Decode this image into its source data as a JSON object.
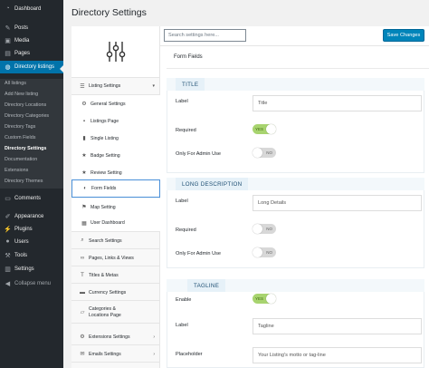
{
  "wp_menu": {
    "items": [
      {
        "label": "Dashboard",
        "icon": "dashboard-icon"
      },
      {
        "label": "Posts",
        "icon": "pin-icon"
      },
      {
        "label": "Media",
        "icon": "media-icon"
      },
      {
        "label": "Pages",
        "icon": "page-icon"
      },
      {
        "label": "Directory listings",
        "icon": "globe-icon"
      }
    ],
    "submenu": [
      "All listings",
      "Add New listing",
      "Directory Locations",
      "Directory Categories",
      "Directory Tags",
      "Custom Fields",
      "Directory Settings",
      "Documentation",
      "Extensions",
      "Directory Themes"
    ],
    "bottom_items": [
      {
        "label": "Comments",
        "icon": "comment-icon"
      },
      {
        "label": "Appearance",
        "icon": "brush-icon"
      },
      {
        "label": "Plugins",
        "icon": "plug-icon"
      },
      {
        "label": "Users",
        "icon": "user-icon"
      },
      {
        "label": "Tools",
        "icon": "wrench-icon"
      },
      {
        "label": "Settings",
        "icon": "settings-icon"
      },
      {
        "label": "Collapse menu",
        "icon": "collapse-icon"
      }
    ]
  },
  "page": {
    "title": "Directory Settings",
    "search_placeholder": "Search settings here...",
    "save_label": "Save Changes",
    "content_title": "Form Fields"
  },
  "settings_nav": {
    "listing_settings": "Listing Settings",
    "sub_items": [
      "General Settings",
      "Listings Page",
      "Single Listing",
      "Badge Setting",
      "Review Setting",
      "Form Fields",
      "Map Setting",
      "User Dashboard"
    ],
    "groups": [
      "Search Settings",
      "Pages, Links & Views",
      "Titles & Metas",
      "Currency Settings",
      "Categories & Locations Page",
      "Extensions Settings",
      "Emails Settings"
    ]
  },
  "sections": {
    "title": {
      "heading": "TITLE",
      "label_lbl": "Label",
      "label_value": "Title",
      "required_lbl": "Required",
      "required_state": "YES",
      "admin_lbl": "Only For Admin Use",
      "admin_state": "NO"
    },
    "long_description": {
      "heading": "LONG DESCRIPTION",
      "label_lbl": "Label",
      "label_value": "Long Details",
      "required_lbl": "Required",
      "required_state": "NO",
      "admin_lbl": "Only For Admin Use",
      "admin_state": "NO"
    },
    "tagline": {
      "heading": "TAGLINE",
      "enable_lbl": "Enable",
      "enable_state": "YES",
      "label_lbl": "Label",
      "label_value": "Tagline",
      "placeholder_lbl": "Placeholder",
      "placeholder_value": "Your Listing's motto or tag-line"
    }
  }
}
